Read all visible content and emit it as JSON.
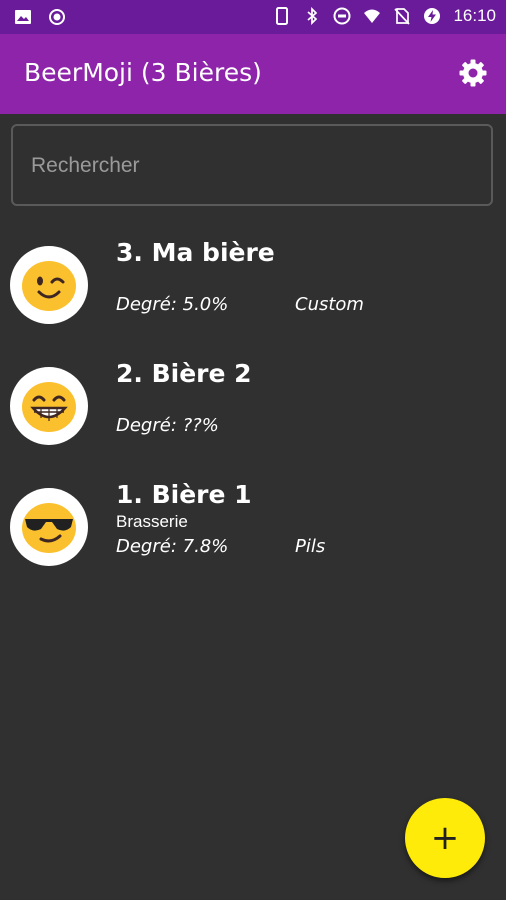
{
  "status_bar": {
    "left_icons": [
      "image-icon",
      "record-icon"
    ],
    "right_icons": [
      "phone-icon",
      "bluetooth-icon",
      "do-not-disturb-icon",
      "wifi-icon",
      "no-sim-icon",
      "battery-charging-icon"
    ],
    "time": "16:10"
  },
  "app_bar": {
    "title": "BeerMoji (3 Bières)",
    "settings_icon": "gear-icon",
    "color": "#8e24aa"
  },
  "search": {
    "placeholder": "Rechercher",
    "value": ""
  },
  "beers": [
    {
      "name": "3. Ma bière",
      "brewery": "",
      "degree": "Degré: 5.0%",
      "style": "Custom",
      "emoji": "wink-emoji"
    },
    {
      "name": "2. Bière 2",
      "brewery": "",
      "degree": "Degré: ??%",
      "style": "",
      "emoji": "grin-emoji"
    },
    {
      "name": "1. Bière 1",
      "brewery": "Brasserie",
      "degree": "Degré: 7.8%",
      "style": "Pils",
      "emoji": "sunglasses-emoji"
    }
  ],
  "fab": {
    "label": "+",
    "color": "#ffeb0a"
  }
}
